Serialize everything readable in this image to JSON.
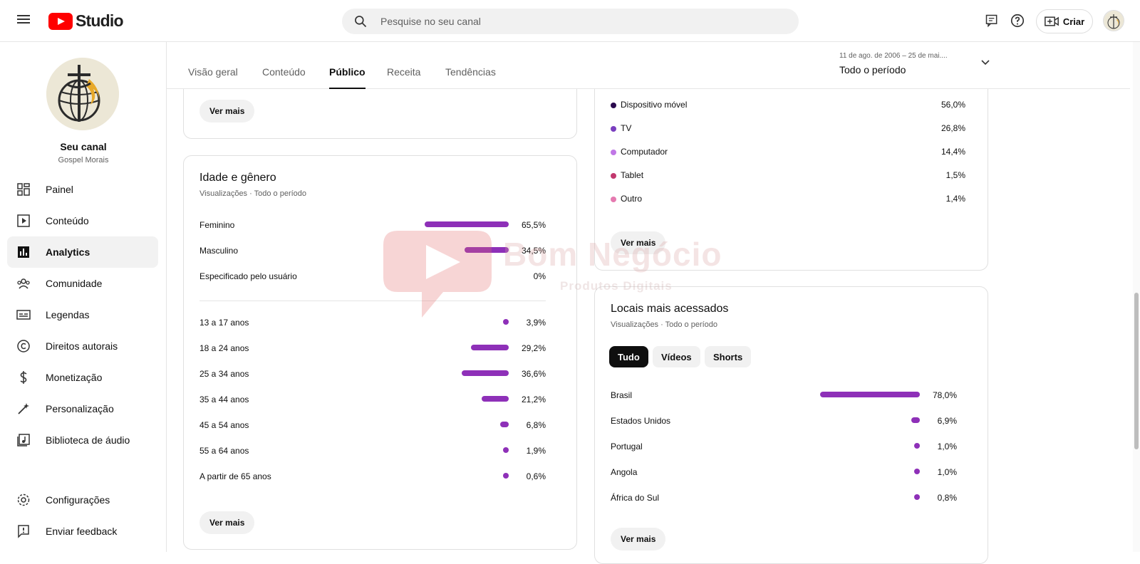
{
  "topbar": {
    "logo_text": "Studio",
    "search_placeholder": "Pesquise no seu canal",
    "create_label": "Criar"
  },
  "sidebar": {
    "channel_name": "Seu canal",
    "channel_handle": "Gospel Morais",
    "items": [
      {
        "label": "Painel",
        "icon": "dashboard-icon"
      },
      {
        "label": "Conteúdo",
        "icon": "content-icon"
      },
      {
        "label": "Analytics",
        "icon": "analytics-icon",
        "active": true
      },
      {
        "label": "Comunidade",
        "icon": "community-icon"
      },
      {
        "label": "Legendas",
        "icon": "subtitles-icon"
      },
      {
        "label": "Direitos autorais",
        "icon": "copyright-icon"
      },
      {
        "label": "Monetização",
        "icon": "monetization-icon"
      },
      {
        "label": "Personalização",
        "icon": "customization-icon"
      },
      {
        "label": "Biblioteca de áudio",
        "icon": "audio-library-icon"
      }
    ],
    "bottom_items": [
      {
        "label": "Configurações",
        "icon": "settings-icon"
      },
      {
        "label": "Enviar feedback",
        "icon": "feedback-icon"
      }
    ]
  },
  "tabs": [
    {
      "label": "Visão geral"
    },
    {
      "label": "Conteúdo"
    },
    {
      "label": "Público",
      "active": true
    },
    {
      "label": "Receita"
    },
    {
      "label": "Tendências"
    }
  ],
  "period": {
    "range": "11 de ago. de 2006 – 25 de mai....",
    "label": "Todo o período"
  },
  "top_card": {
    "see_more": "Ver mais"
  },
  "age_gender": {
    "title": "Idade e gênero",
    "subtitle": "Visualizações · Todo o período",
    "gender": [
      {
        "label": "Feminino",
        "value": "65,5%",
        "fraction": 0.655
      },
      {
        "label": "Masculino",
        "value": "34,5%",
        "fraction": 0.345
      },
      {
        "label": "Especificado pelo usuário",
        "value": "0%",
        "fraction": 0
      }
    ],
    "ages": [
      {
        "label": "13 a 17 anos",
        "value": "3,9%",
        "fraction": 0.039
      },
      {
        "label": "18 a 24 anos",
        "value": "29,2%",
        "fraction": 0.292
      },
      {
        "label": "25 a 34 anos",
        "value": "36,6%",
        "fraction": 0.366
      },
      {
        "label": "35 a 44 anos",
        "value": "21,2%",
        "fraction": 0.212
      },
      {
        "label": "45 a 54 anos",
        "value": "6,8%",
        "fraction": 0.068
      },
      {
        "label": "55 a 64 anos",
        "value": "1,9%",
        "fraction": 0.019
      },
      {
        "label": "A partir de 65 anos",
        "value": "0,6%",
        "fraction": 0.006
      }
    ],
    "see_more": "Ver mais"
  },
  "devices": {
    "items": [
      {
        "label": "Dispositivo móvel",
        "value": "56,0%",
        "color": "#2b0a4e"
      },
      {
        "label": "TV",
        "value": "26,8%",
        "color": "#7a3fbf"
      },
      {
        "label": "Computador",
        "value": "14,4%",
        "color": "#c077e6"
      },
      {
        "label": "Tablet",
        "value": "1,5%",
        "color": "#c2386e"
      },
      {
        "label": "Outro",
        "value": "1,4%",
        "color": "#e57ab0"
      }
    ],
    "see_more": "Ver mais"
  },
  "locations": {
    "title": "Locais mais acessados",
    "subtitle": "Visualizações · Todo o período",
    "chips": [
      {
        "label": "Tudo",
        "active": true
      },
      {
        "label": "Vídeos"
      },
      {
        "label": "Shorts"
      }
    ],
    "rows": [
      {
        "label": "Brasil",
        "value": "78,0%",
        "fraction": 0.78
      },
      {
        "label": "Estados Unidos",
        "value": "6,9%",
        "fraction": 0.069
      },
      {
        "label": "Portugal",
        "value": "1,0%",
        "fraction": 0.01
      },
      {
        "label": "Angola",
        "value": "1,0%",
        "fraction": 0.01
      },
      {
        "label": "África do Sul",
        "value": "0,8%",
        "fraction": 0.008
      }
    ],
    "see_more": "Ver mais"
  },
  "watermark": {
    "brand": "Bom Negócio",
    "tagline": "Produtos Digitais"
  },
  "colors": {
    "bar": "#8e30b8",
    "accent": "#ff0000"
  }
}
